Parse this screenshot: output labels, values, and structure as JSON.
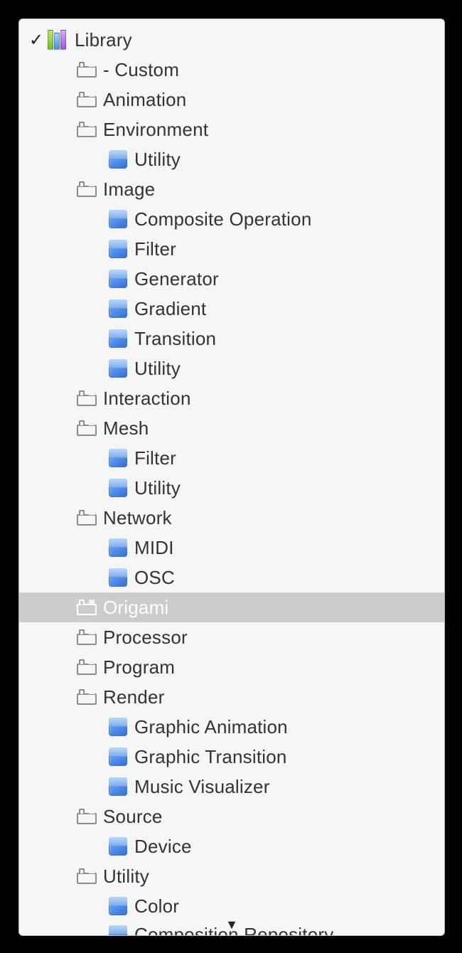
{
  "tree": {
    "checkmark": "✓",
    "root_label": "Library",
    "nodes": [
      {
        "depth": 1,
        "icon": "brick",
        "label": "- Custom",
        "selected": false
      },
      {
        "depth": 1,
        "icon": "brick",
        "label": "Animation",
        "selected": false
      },
      {
        "depth": 1,
        "icon": "brick",
        "label": "Environment",
        "selected": false
      },
      {
        "depth": 2,
        "icon": "cube",
        "label": "Utility",
        "selected": false
      },
      {
        "depth": 1,
        "icon": "brick",
        "label": "Image",
        "selected": false
      },
      {
        "depth": 2,
        "icon": "cube",
        "label": "Composite Operation",
        "selected": false
      },
      {
        "depth": 2,
        "icon": "cube",
        "label": "Filter",
        "selected": false
      },
      {
        "depth": 2,
        "icon": "cube",
        "label": "Generator",
        "selected": false
      },
      {
        "depth": 2,
        "icon": "cube",
        "label": "Gradient",
        "selected": false
      },
      {
        "depth": 2,
        "icon": "cube",
        "label": "Transition",
        "selected": false
      },
      {
        "depth": 2,
        "icon": "cube",
        "label": "Utility",
        "selected": false
      },
      {
        "depth": 1,
        "icon": "brick",
        "label": "Interaction",
        "selected": false
      },
      {
        "depth": 1,
        "icon": "brick",
        "label": "Mesh",
        "selected": false
      },
      {
        "depth": 2,
        "icon": "cube",
        "label": "Filter",
        "selected": false
      },
      {
        "depth": 2,
        "icon": "cube",
        "label": "Utility",
        "selected": false
      },
      {
        "depth": 1,
        "icon": "brick",
        "label": "Network",
        "selected": false
      },
      {
        "depth": 2,
        "icon": "cube",
        "label": "MIDI",
        "selected": false
      },
      {
        "depth": 2,
        "icon": "cube",
        "label": "OSC",
        "selected": false
      },
      {
        "depth": 1,
        "icon": "brick",
        "label": "Origami",
        "selected": true
      },
      {
        "depth": 1,
        "icon": "brick",
        "label": "Processor",
        "selected": false
      },
      {
        "depth": 1,
        "icon": "brick",
        "label": "Program",
        "selected": false
      },
      {
        "depth": 1,
        "icon": "brick",
        "label": "Render",
        "selected": false
      },
      {
        "depth": 2,
        "icon": "cube",
        "label": "Graphic Animation",
        "selected": false
      },
      {
        "depth": 2,
        "icon": "cube",
        "label": "Graphic Transition",
        "selected": false
      },
      {
        "depth": 2,
        "icon": "cube",
        "label": "Music Visualizer",
        "selected": false
      },
      {
        "depth": 1,
        "icon": "brick",
        "label": "Source",
        "selected": false
      },
      {
        "depth": 2,
        "icon": "cube",
        "label": "Device",
        "selected": false
      },
      {
        "depth": 1,
        "icon": "brick",
        "label": "Utility",
        "selected": false
      },
      {
        "depth": 2,
        "icon": "cube",
        "label": "Color",
        "selected": false
      },
      {
        "depth": 2,
        "icon": "cube",
        "label": "Composition Repository",
        "selected": false,
        "lastCut": true
      }
    ],
    "scroll_indicator": "▼"
  }
}
